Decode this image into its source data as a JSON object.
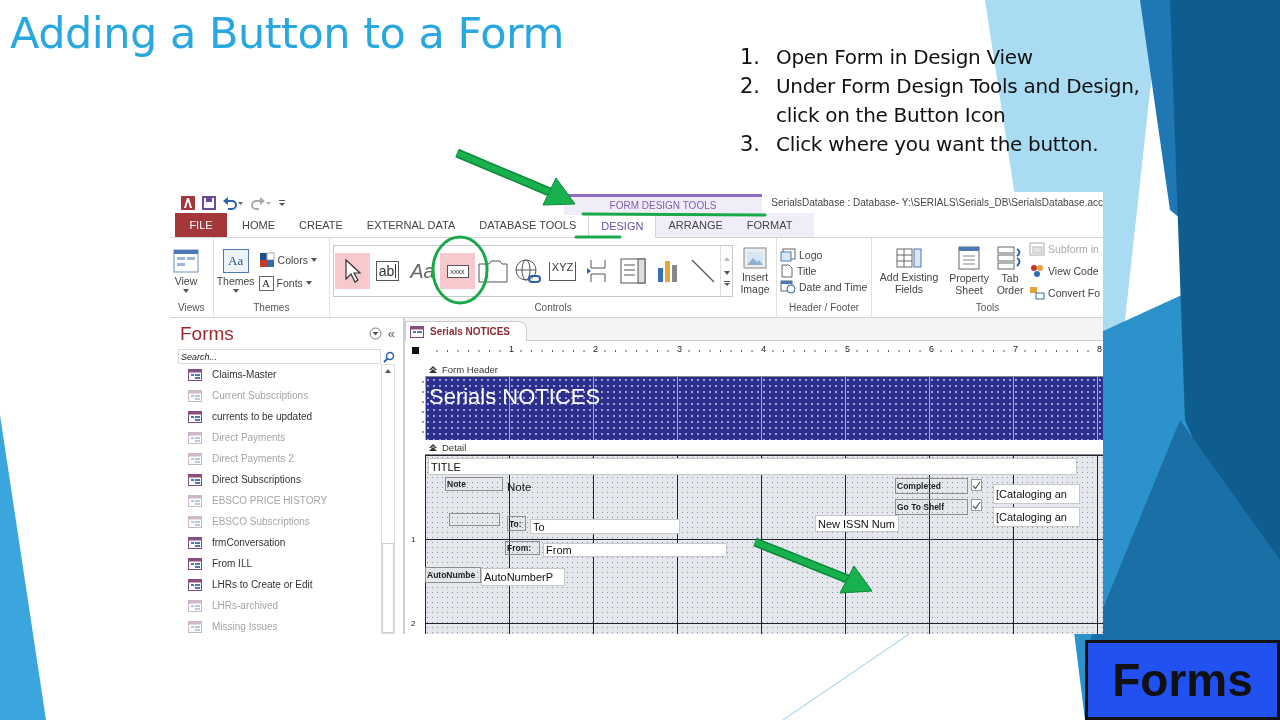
{
  "slide": {
    "title": "Adding a Button to a Form",
    "badge": "Forms",
    "steps": [
      {
        "number": "1.",
        "text": "Open Form in Design View"
      },
      {
        "number": "2.",
        "text": "Under Form Design Tools and Design, click on the Button Icon"
      },
      {
        "number": "3.",
        "text": "Click where you want the button."
      }
    ]
  },
  "window": {
    "title": "SerialsDatabase : Database- Y:\\SERIALS\\Serials_DB\\SerialsDatabase.acc",
    "context_header": "FORM DESIGN TOOLS"
  },
  "tabs": [
    {
      "label": "FILE",
      "kind": "file",
      "selected": false
    },
    {
      "label": "HOME",
      "kind": "normal",
      "selected": false
    },
    {
      "label": "CREATE",
      "kind": "normal",
      "selected": false
    },
    {
      "label": "EXTERNAL DATA",
      "kind": "normal",
      "selected": false
    },
    {
      "label": "DATABASE TOOLS",
      "kind": "normal",
      "selected": false
    },
    {
      "label": "DESIGN",
      "kind": "contextual",
      "selected": true
    },
    {
      "label": "ARRANGE",
      "kind": "contextual",
      "selected": false
    },
    {
      "label": "FORMAT",
      "kind": "contextual",
      "selected": false
    }
  ],
  "ribbon": {
    "views": {
      "label": "Views",
      "button": "View"
    },
    "themes": {
      "label": "Themes",
      "button": "Themes",
      "glyph": "Aa",
      "colors": "Colors",
      "fonts": "Fonts",
      "fonts_glyph": "A"
    },
    "controls": {
      "label": "Controls",
      "insert_image": "Insert Image",
      "gallery": [
        {
          "kind": "pointer",
          "highlighted": true
        },
        {
          "kind": "textbox",
          "glyph": "ab",
          "highlighted": false
        },
        {
          "kind": "label",
          "glyph": "Aa",
          "highlighted": false
        },
        {
          "kind": "button",
          "glyph": "xxxx",
          "highlighted": true
        },
        {
          "kind": "tab",
          "highlighted": false
        },
        {
          "kind": "hyperlink",
          "highlighted": false
        },
        {
          "kind": "option_group",
          "glyph": "XYZ",
          "highlighted": false
        },
        {
          "kind": "page_break",
          "highlighted": false
        },
        {
          "kind": "combo",
          "highlighted": false
        },
        {
          "kind": "chart",
          "highlighted": false
        },
        {
          "kind": "line",
          "highlighted": false
        }
      ]
    },
    "header_footer": {
      "label": "Header / Footer",
      "items": [
        "Logo",
        "Title",
        "Date and Time"
      ]
    },
    "tools": {
      "label": "Tools",
      "large": [
        "Add Existing Fields",
        "Property Sheet",
        "Tab Order"
      ],
      "small": [
        {
          "label": "Subform in",
          "disabled": true
        },
        {
          "label": "View Code",
          "disabled": false
        },
        {
          "label": "Convert Fo",
          "disabled": false
        }
      ]
    }
  },
  "nav": {
    "title": "Forms",
    "collapse": "«",
    "search_placeholder": "Search...",
    "items": [
      {
        "label": "Claims-Master",
        "dimmed": false
      },
      {
        "label": "Current Subscriptions",
        "dimmed": true
      },
      {
        "label": "currents to be updated",
        "dimmed": false
      },
      {
        "label": "Direct Payments",
        "dimmed": true
      },
      {
        "label": "Direct Payments 2",
        "dimmed": true
      },
      {
        "label": "Direct Subscriptions",
        "dimmed": false
      },
      {
        "label": "EBSCO PRICE HISTORY",
        "dimmed": true
      },
      {
        "label": "EBSCO Subscriptions",
        "dimmed": true
      },
      {
        "label": "frmConversation",
        "dimmed": false
      },
      {
        "label": "From ILL",
        "dimmed": false
      },
      {
        "label": "LHRs to Create or Edit",
        "dimmed": false
      },
      {
        "label": "LHRs-archived",
        "dimmed": true
      },
      {
        "label": "Missing Issues",
        "dimmed": true
      }
    ]
  },
  "document": {
    "tab": "Serials NOTICES",
    "ruler": [
      "1",
      "2",
      "3",
      "4",
      "5",
      "6",
      "7",
      "8"
    ],
    "vertical_ruler": [
      "1",
      "2"
    ],
    "form_header": {
      "label": "Form Header",
      "caption": "Serials NOTICES"
    },
    "detail": {
      "label": "Detail",
      "controls": [
        {
          "kind": "textbox",
          "text": "TITLE"
        },
        {
          "kind": "label",
          "text": "Note"
        },
        {
          "kind": "text",
          "text": "Note"
        },
        {
          "kind": "label"
        },
        {
          "kind": "label",
          "text": "To:"
        },
        {
          "kind": "textbox",
          "text": "To"
        },
        {
          "kind": "label",
          "text": "From:"
        },
        {
          "kind": "textbox",
          "text": "From"
        },
        {
          "kind": "label",
          "text": "AutoNumbe"
        },
        {
          "kind": "textbox",
          "text": "AutoNumberP"
        },
        {
          "kind": "textbox",
          "text": "New ISSN Num"
        },
        {
          "kind": "label",
          "text": "Completed"
        },
        {
          "kind": "checkbox",
          "checked": true
        },
        {
          "kind": "label",
          "text": "Go To Shelf"
        },
        {
          "kind": "checkbox",
          "checked": true
        },
        {
          "kind": "textbox",
          "text": "[Cataloging an"
        },
        {
          "kind": "textbox",
          "text": "[Cataloging an"
        }
      ]
    }
  }
}
